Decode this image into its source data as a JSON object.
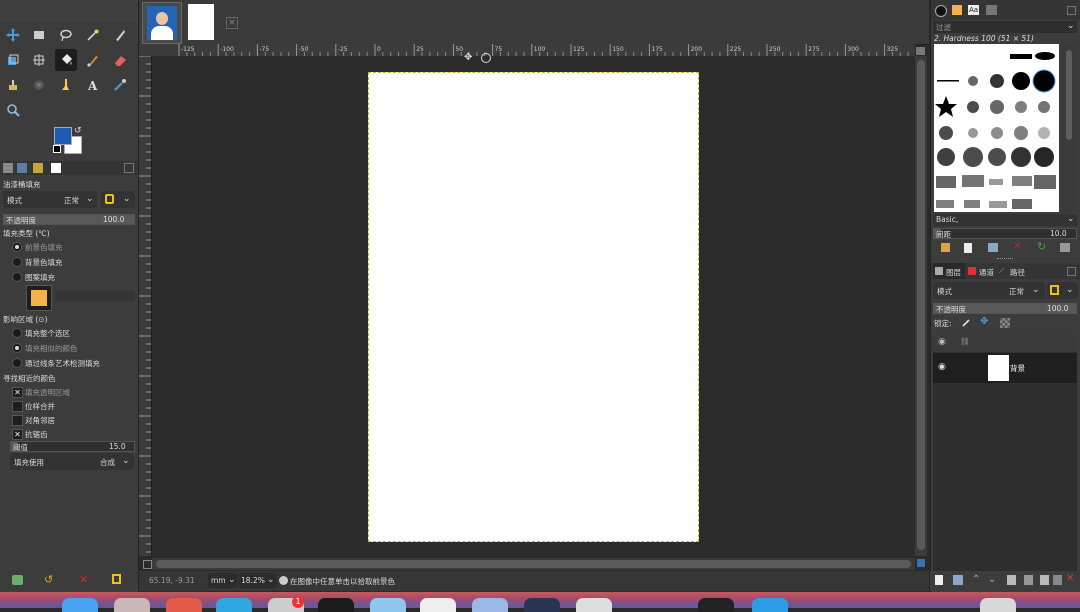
{
  "toolbox": {
    "tools": [
      "move-tool",
      "rect-select-tool",
      "lasso-tool",
      "fuzzy-select-tool",
      "paths-tool",
      "crop-tool",
      "transform-tool",
      "bucket-fill-tool",
      "paintbrush-tool",
      "eraser-tool",
      "clone-tool",
      "smudge-tool",
      "dodge-tool",
      "text-tool",
      "color-picker-tool",
      "zoom-tool"
    ],
    "fg_color": "#1e5bb3",
    "bg_color": "#ffffff"
  },
  "tool_options": {
    "title": "油漆桶填充",
    "mode_label": "模式",
    "mode_value": "正常",
    "opacity_label": "不透明度",
    "opacity_value": "100.0",
    "fill_type_label": "填充类型 (℃)",
    "fill_fg": "前景色填充",
    "fill_bg": "背景色填充",
    "fill_pattern": "图案填充",
    "pattern_color": "#f3b24a",
    "affected_label": "影响区域 (⊙)",
    "affect_whole": "填充整个选区",
    "affect_similar": "填充相似的颜色",
    "affect_lineart": "通过线条艺术检测填充",
    "similar_label": "寻找相近的颜色",
    "opt_transparent": "填充透明区域",
    "opt_merged": "位样合并",
    "opt_diagonal": "对角邻居",
    "opt_antialias": "抗锯齿",
    "threshold_label": "阈值",
    "threshold_value": "15.0",
    "fill_by_label": "填充使用",
    "fill_by_value": "合成"
  },
  "ruler_labels": [
    "-125",
    "-100",
    "-75",
    "-50",
    "-25",
    "0",
    "25",
    "50",
    "75",
    "100",
    "125",
    "150",
    "175",
    "200",
    "225",
    "250",
    "275",
    "300",
    "325"
  ],
  "status": {
    "coords": "65.19, -9.31",
    "unit": "mm",
    "zoom": "18.2%",
    "message": "在图像中任意单击以拾取前景色"
  },
  "dock": {
    "filter_placeholder": "过滤",
    "brush_name": "2. Hardness 100 (51 × 51)",
    "brush_set": "Basic,",
    "spacing_label": "间距",
    "spacing_value": "10.0",
    "tab_layers": "图层",
    "tab_channels": "通道",
    "tab_paths": "路径",
    "layer_mode_label": "模式",
    "layer_mode_value": "正常",
    "layer_opacity_label": "不透明度",
    "layer_opacity_value": "100.0",
    "lock_label": "锁定:",
    "layer_name": "背景"
  }
}
